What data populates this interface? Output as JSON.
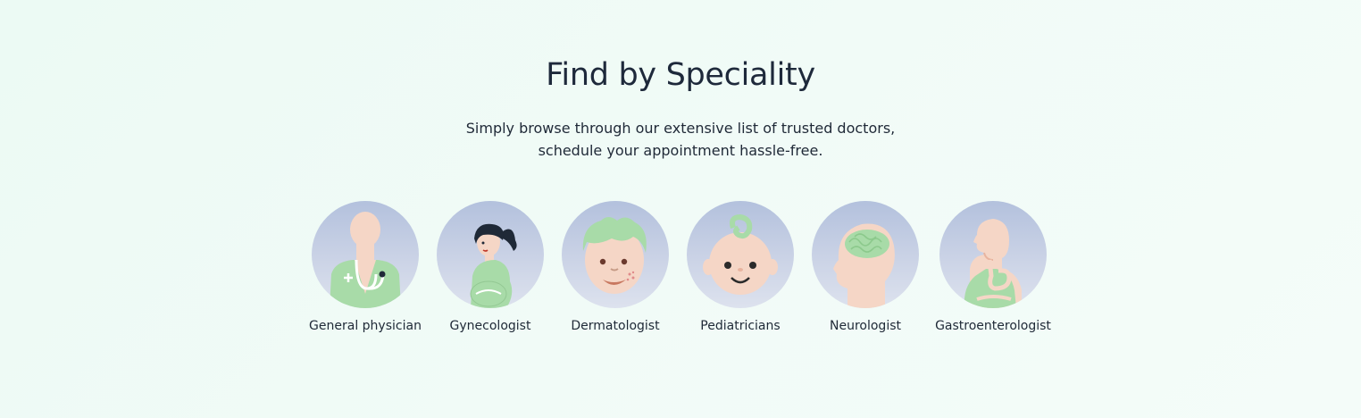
{
  "section": {
    "title": "Find by Speciality",
    "subtitle_line1": "Simply browse through our extensive list of trusted doctors,",
    "subtitle_line2": "schedule your appointment hassle-free."
  },
  "specialities": [
    {
      "label": "General physician",
      "icon": "general-physician-icon"
    },
    {
      "label": "Gynecologist",
      "icon": "gynecologist-icon"
    },
    {
      "label": "Dermatologist",
      "icon": "dermatologist-icon"
    },
    {
      "label": "Pediatricians",
      "icon": "pediatricians-icon"
    },
    {
      "label": "Neurologist",
      "icon": "neurologist-icon"
    },
    {
      "label": "Gastroenterologist",
      "icon": "gastroenterologist-icon"
    }
  ],
  "colors": {
    "icon_bg_top": "#b3c1dd",
    "icon_bg_bottom": "#dde2ee",
    "accent_green": "#a8dba8",
    "skin": "#f7d7c6",
    "title": "#1e293b"
  }
}
